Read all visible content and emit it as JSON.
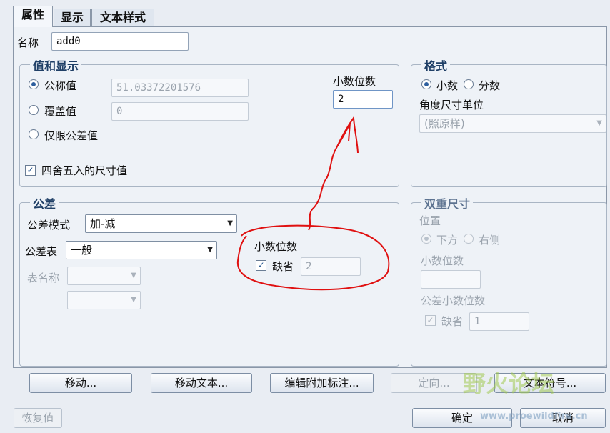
{
  "tabs": [
    {
      "label": "属性"
    },
    {
      "label": "显示"
    },
    {
      "label": "文本样式"
    }
  ],
  "name_row": {
    "label": "名称",
    "value": "add0"
  },
  "value_display": {
    "title": "值和显示",
    "nominal_label": "公称值",
    "nominal_value": "51.03372201576",
    "override_label": "覆盖值",
    "override_value": "0",
    "tolerance_only_label": "仅限公差值",
    "decimals_label": "小数位数",
    "decimals_value": "2",
    "round_label": "四舍五入的尺寸值",
    "selected": "nominal",
    "round_checked": true
  },
  "format": {
    "title": "格式",
    "decimal_label": "小数",
    "fraction_label": "分数",
    "selected": "decimal",
    "angle_unit_label": "角度尺寸单位",
    "angle_unit_value": "(照原样)"
  },
  "tolerance": {
    "title": "公差",
    "mode_label": "公差模式",
    "mode_value": "加-减",
    "table_label": "公差表",
    "table_value": "一般",
    "table_name_label": "表名称",
    "decimals_label": "小数位数",
    "default_label": "缺省",
    "decimals_value": "2",
    "default_checked": true
  },
  "dual": {
    "title": "双重尺寸",
    "position_label": "位置",
    "below_label": "下方",
    "right_label": "右侧",
    "selected": "below",
    "decimals_label": "小数位数",
    "tol_decimals_label": "公差小数位数",
    "default_label": "缺省",
    "tol_decimals_value": "1"
  },
  "buttons": {
    "move": "移动...",
    "move_text": "移动文本...",
    "edit_attached": "编辑附加标注...",
    "direction": "定向...",
    "text_symbol": "文本符号...",
    "restore": "恢复值",
    "ok": "确定",
    "cancel": "取消"
  },
  "watermark": {
    "text1": "野火论坛",
    "text2": "www.proewildfire.cn"
  },
  "colors": {
    "annotation": "#e01010",
    "accent": "#1f3f66",
    "panel_bg": "#eef2f7"
  }
}
